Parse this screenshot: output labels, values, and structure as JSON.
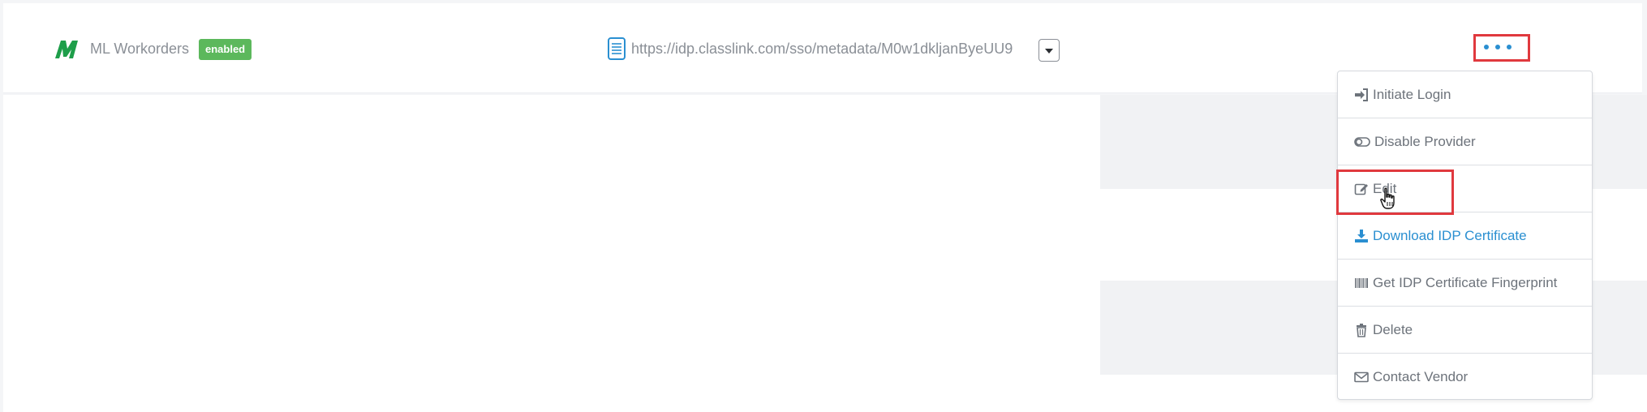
{
  "provider": {
    "name": "ML Workorders",
    "status": "enabled",
    "metadata_url": "https://idp.classlink.com/sso/metadata/M0w1dkljanByeUU9"
  },
  "icons": {
    "logo": "ml-logo-icon",
    "metadata": "document-icon",
    "dropdown": "caret-down-icon",
    "more": "ellipsis-icon",
    "cursor": "hand-pointer-cursor"
  },
  "menu": {
    "items": [
      {
        "label": "Initiate Login",
        "icon": "sign-in-icon"
      },
      {
        "label": "Disable Provider",
        "icon": "toggle-off-icon"
      },
      {
        "label": "Edit",
        "icon": "edit-icon"
      },
      {
        "label": "Download IDP Certificate",
        "icon": "download-icon"
      },
      {
        "label": "Get IDP Certificate Fingerprint",
        "icon": "barcode-icon"
      },
      {
        "label": "Delete",
        "icon": "trash-icon"
      },
      {
        "label": "Contact Vendor",
        "icon": "envelope-icon"
      }
    ]
  },
  "colors": {
    "badge": "#5cb85c",
    "logo": "#1e9e4a",
    "accent": "#2a8fd1",
    "highlight": "#e0393e"
  }
}
